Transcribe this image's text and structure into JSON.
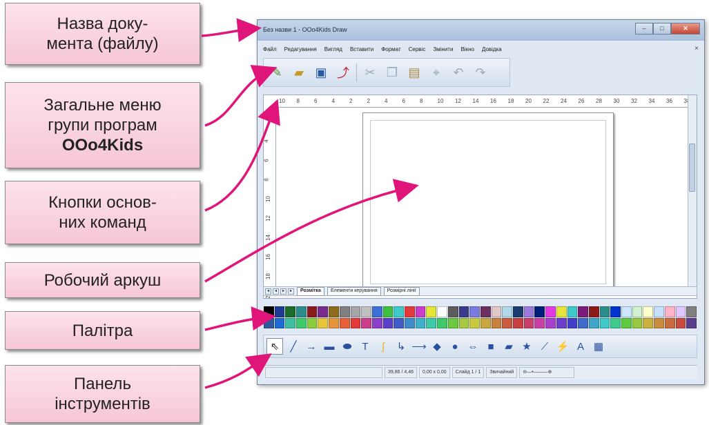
{
  "callouts": {
    "doc_name": {
      "line1": "Назва доку-",
      "line2": "мента (файлу)"
    },
    "main_menu": {
      "line1": "Загальне меню",
      "line2": "групи програм",
      "line3": "OOo4Kids"
    },
    "main_buttons": {
      "line1": "Кнопки основ-",
      "line2": "них команд"
    },
    "worksheet": {
      "line1": "Робочий аркуш"
    },
    "palette": {
      "line1": "Палітра"
    },
    "toolbar": {
      "line1": "Панель",
      "line2": "інструментів"
    }
  },
  "window": {
    "title": "Без назви 1 - OOo4Kids Draw",
    "menu": [
      "Файл",
      "Редагування",
      "Вигляд",
      "Вставити",
      "Формат",
      "Сервіс",
      "Змінити",
      "Вікно",
      "Довідка"
    ],
    "hruler_ticks": [
      "10",
      "8",
      "6",
      "4",
      "2",
      "2",
      "4",
      "6",
      "8",
      "10",
      "12",
      "14",
      "16",
      "18",
      "20",
      "22",
      "24",
      "26",
      "28",
      "30",
      "32",
      "34",
      "36",
      "38"
    ],
    "vruler_ticks": [
      "4",
      "6",
      "8",
      "10",
      "12",
      "14",
      "16",
      "18",
      "20"
    ],
    "tabs": [
      "Розмітка",
      "Елементи керування",
      "Розмірні лінії"
    ],
    "status": {
      "position": "39,86 / 4,46",
      "size": "0,00 x 0,00",
      "slide": "Слайд 1 / 1",
      "layout": "Звичайний"
    }
  },
  "palette_colors": [
    "#000000",
    "#1f3a93",
    "#1c6b2a",
    "#2c8c8c",
    "#8b1a1a",
    "#7a2a8c",
    "#8c6b1c",
    "#7f7f7f",
    "#a6a6a6",
    "#c0c0c0",
    "#3d6fd6",
    "#3fbf3f",
    "#3fc9c9",
    "#e23a3a",
    "#c93fc9",
    "#e6e63a",
    "#ffffff",
    "#5c5c5c",
    "#3b3b8c",
    "#7a7ae0",
    "#6c2f5e",
    "#e0c8c8",
    "#b0d8e8",
    "#1a3c6e",
    "#9b7ae0",
    "#001f7a",
    "#e23ae2",
    "#e6e63a",
    "#3fc9c9",
    "#7a1c7a",
    "#8c1c1c",
    "#2c8c8c",
    "#0033cc",
    "#cce6ff",
    "#d2f0d2",
    "#ffffcc",
    "#c8e0ff",
    "#ffb3c6",
    "#e0c8ff",
    "#7f7f7f",
    "#2c5aa0",
    "#1f6bd6",
    "#3fbf9e",
    "#3fc96b",
    "#8ccc3f",
    "#e6c63a",
    "#e6963a",
    "#e6603a",
    "#e23a3a",
    "#c93f8c",
    "#8c3fc9",
    "#5c3fc9",
    "#3f5cc9",
    "#3f8cc9",
    "#3fb0c9",
    "#3fc9a6",
    "#3fc96b",
    "#6bc93f",
    "#a6c93f",
    "#c9c93f",
    "#c9a63f",
    "#c9803f",
    "#c95c3f",
    "#c93f3f",
    "#c93f6b",
    "#c93fa6",
    "#a63fc9",
    "#6b3fc9",
    "#3f3fc9",
    "#3f6bc9",
    "#3fa6c9",
    "#3fc9c9",
    "#3fc98c",
    "#5cc93f",
    "#96c93f",
    "#c9b03f",
    "#c98c3f",
    "#c96b3f",
    "#c94a3f",
    "#5c3f8c"
  ]
}
